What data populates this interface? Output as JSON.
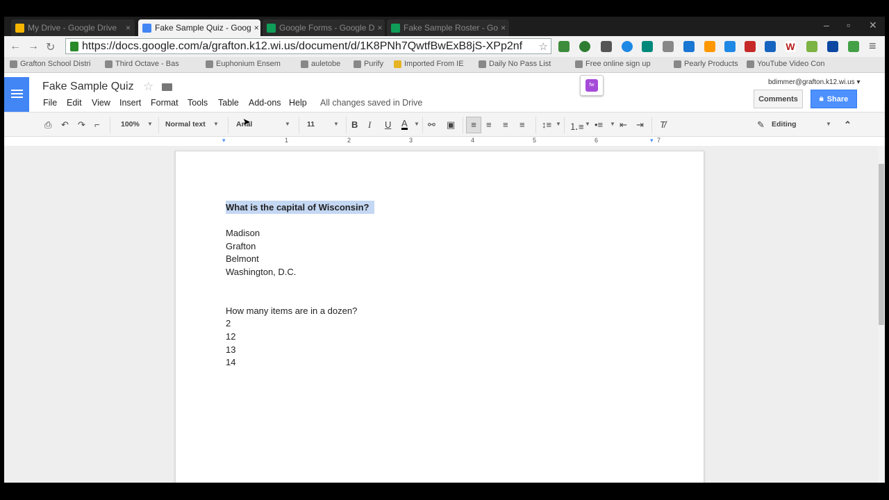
{
  "browser": {
    "tabs": [
      {
        "label": "My Drive - Google Drive",
        "active": false,
        "icon_color": "#f4b400"
      },
      {
        "label": "Fake Sample Quiz - Goog",
        "active": true,
        "icon_color": "#4285f4"
      },
      {
        "label": "Google Forms - Google D",
        "active": false,
        "icon_color": "#0f9d58"
      },
      {
        "label": "Fake Sample Roster - Go",
        "active": false,
        "icon_color": "#0f9d58"
      }
    ],
    "url": "https://docs.google.com/a/grafton.k12.wi.us/document/d/1K8PNh7QwtfBwExB8jS-XPp2nf",
    "bookmarks": [
      "Grafton School Distri",
      "Third Octave - Bas",
      "Euphonium Ensem",
      "auletobe",
      "Purify",
      "Imported From IE",
      "Daily No Pass List",
      "Free online sign up",
      "Pearly Products",
      "YouTube Video Con"
    ]
  },
  "docs": {
    "title": "Fake Sample Quiz",
    "menu": [
      "File",
      "Edit",
      "View",
      "Insert",
      "Format",
      "Tools",
      "Table",
      "Add-ons",
      "Help"
    ],
    "save_status": "All changes saved in Drive",
    "user_email": "bdimmer@grafton.k12.wi.us",
    "comments_label": "Comments",
    "share_label": "Share",
    "addon_badge": "fw"
  },
  "format_toolbar": {
    "zoom": "100%",
    "style": "Normal text",
    "font": "Arial",
    "size": "11",
    "mode": "Editing"
  },
  "ruler": [
    "1",
    "2",
    "3",
    "4",
    "5",
    "6",
    "7"
  ],
  "document": {
    "q1": "What is the capital of Wisconsin?",
    "q1_answers": [
      "Madison",
      "Grafton",
      "Belmont",
      "Washington, D.C."
    ],
    "q2": "How many items are in a dozen?",
    "q2_answers": [
      "2",
      "12",
      "13",
      "14"
    ]
  }
}
